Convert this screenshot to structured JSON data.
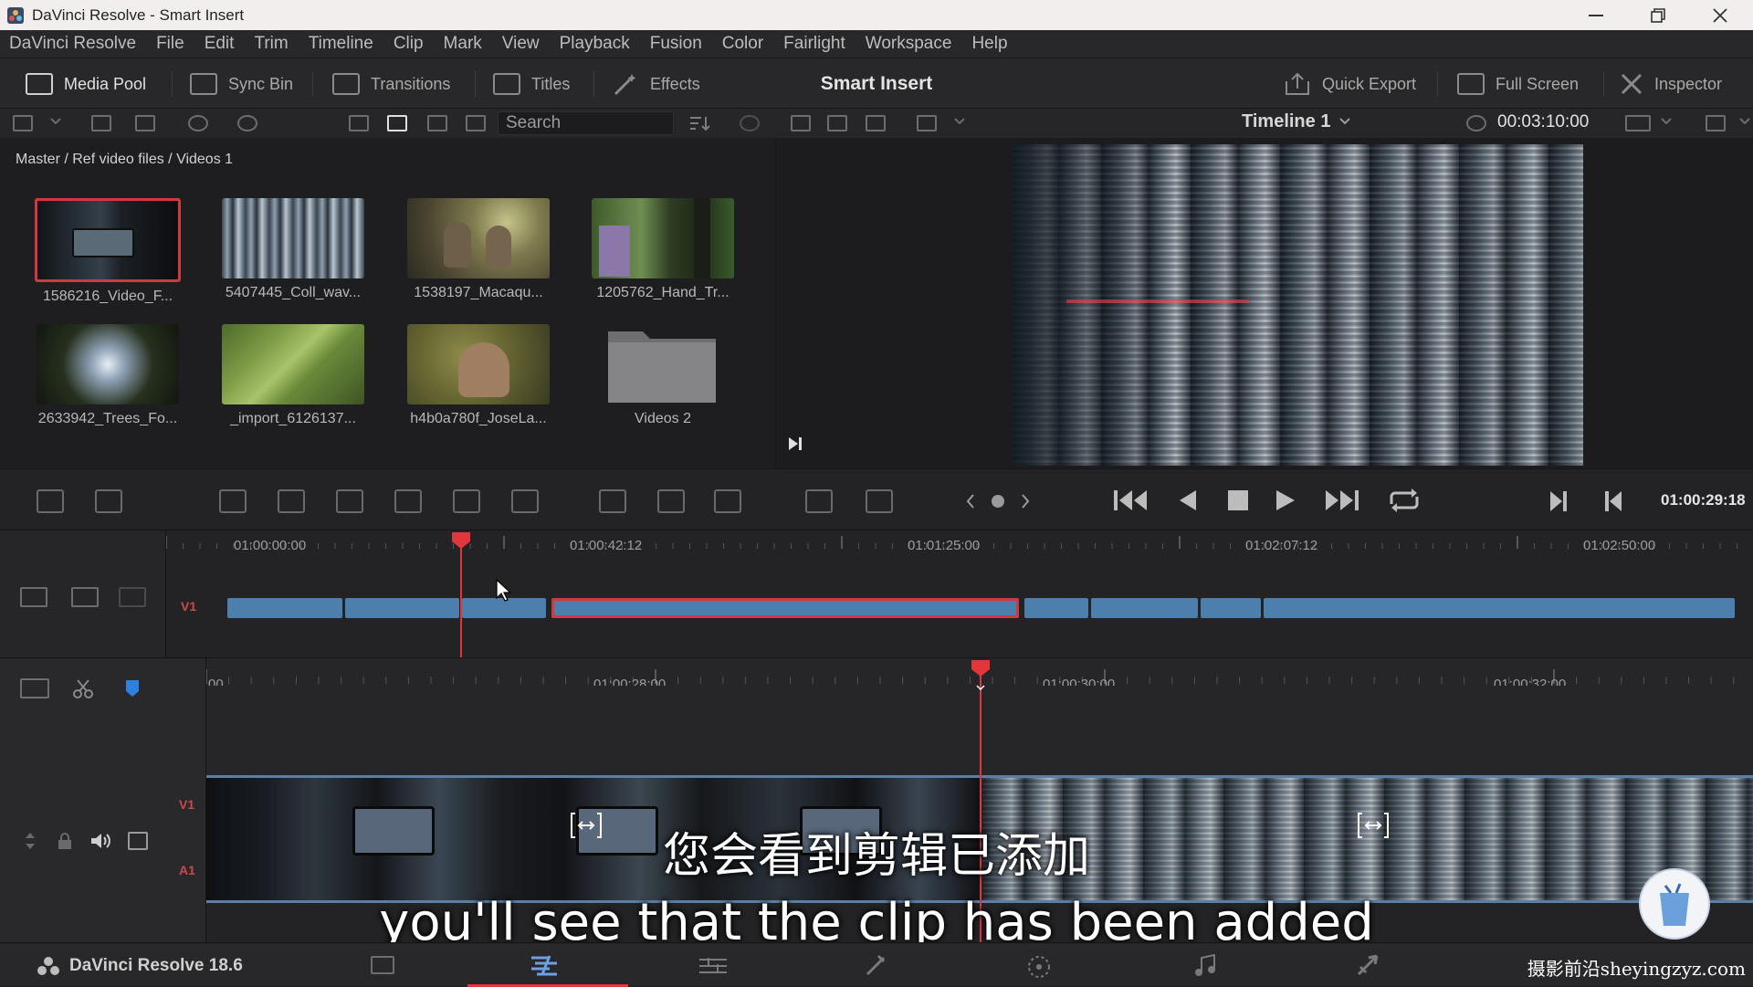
{
  "window": {
    "title": "DaVinci Resolve - Smart Insert"
  },
  "menu": [
    "DaVinci Resolve",
    "File",
    "Edit",
    "Trim",
    "Timeline",
    "Clip",
    "Mark",
    "View",
    "Playback",
    "Fusion",
    "Color",
    "Fairlight",
    "Workspace",
    "Help"
  ],
  "toolbar": {
    "media_pool": "Media Pool",
    "sync_bin": "Sync Bin",
    "transitions": "Transitions",
    "titles": "Titles",
    "effects": "Effects",
    "page_title": "Smart Insert",
    "quick_export": "Quick Export",
    "full_screen": "Full Screen",
    "inspector": "Inspector"
  },
  "search": {
    "placeholder": "Search"
  },
  "viewer": {
    "timeline_name": "Timeline 1",
    "timecode": "00:03:10:00"
  },
  "breadcrumb": "Master / Ref video files / Videos 1",
  "clips": [
    {
      "name": "1586216_Video_F..."
    },
    {
      "name": "5407445_Coll_wav..."
    },
    {
      "name": "1538197_Macaqu..."
    },
    {
      "name": "1205762_Hand_Tr..."
    },
    {
      "name": "2633942_Trees_Fo..."
    },
    {
      "name": "_import_6126137..."
    },
    {
      "name": "h4b0a780f_JoseLa..."
    },
    {
      "name": "Videos 2"
    }
  ],
  "controls": {
    "playhead_timecode": "01:00:29:18"
  },
  "upper_timeline": {
    "track": "V1",
    "ruler": [
      "01:00:00:00",
      "01:00:42:12",
      "01:01:25:00",
      "01:02:07:12",
      "01:02:50:00"
    ]
  },
  "lower_timeline": {
    "ruler": [
      "00",
      "01:00:28:00",
      "01:00:30:00",
      "01:00:32:00"
    ],
    "video_track": "V1",
    "audio_track": "A1"
  },
  "subtitles": {
    "cn": "您会看到剪辑已添加",
    "en": "you'll see that the clip has been added"
  },
  "footer": {
    "version": "DaVinci Resolve 18.6",
    "watermark": "摄影前沿sheyingzyz.com"
  },
  "colors": {
    "playhead": "#e0363c",
    "clip_blue": "#4d7fac",
    "selected_border": "#d03a3e"
  }
}
